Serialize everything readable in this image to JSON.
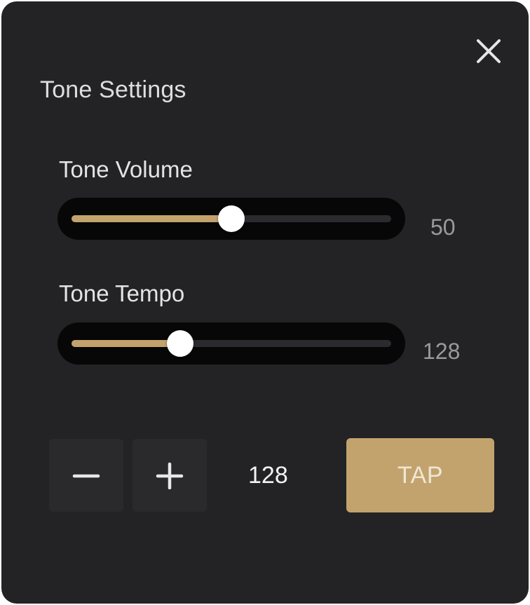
{
  "dialog": {
    "title": "Tone Settings",
    "close_icon": "close-icon"
  },
  "volume": {
    "label": "Tone Volume",
    "value": "50",
    "fill_fraction": 0.5
  },
  "tempo": {
    "label": "Tone Tempo",
    "value": "128",
    "fill_fraction": 0.34
  },
  "controls": {
    "decrement_icon": "minus-icon",
    "increment_icon": "plus-icon",
    "tempo_display": "128",
    "tap_label": "TAP"
  },
  "colors": {
    "panel_background": "#232326",
    "accent": "#c3a36d",
    "track": "#070707",
    "thumb": "#ffffff"
  }
}
